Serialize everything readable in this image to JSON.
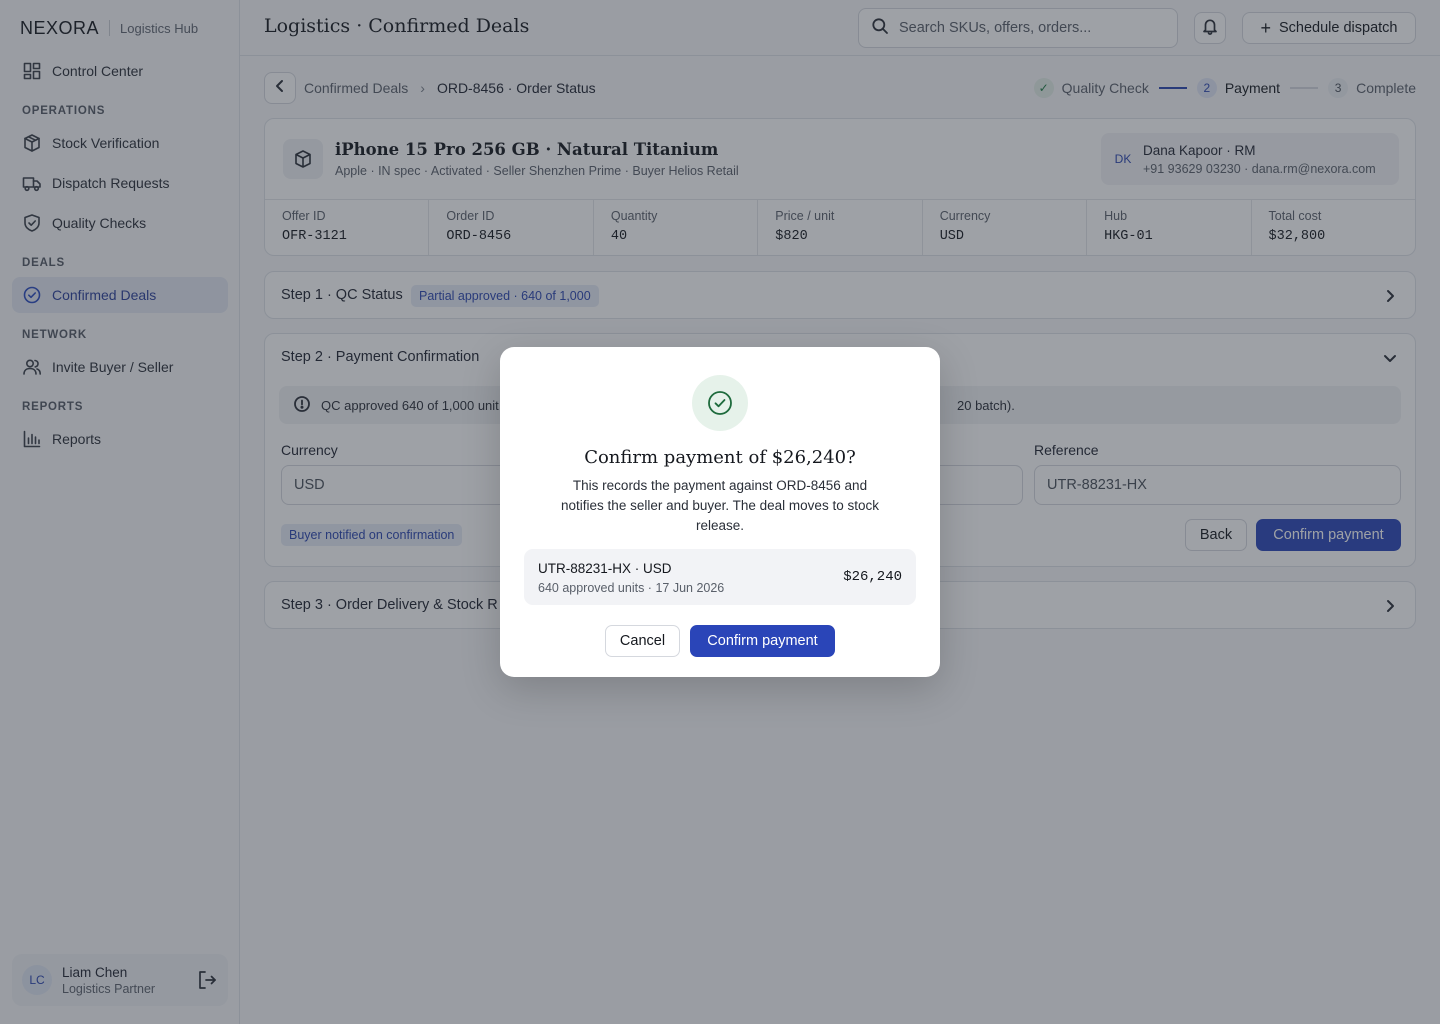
{
  "brand": {
    "logo": "NEXORA",
    "subtitle": "Logistics Hub"
  },
  "sidebar": {
    "items": [
      {
        "label": "Control Center",
        "icon": "dashboard-icon"
      },
      {
        "label": "Stock Verification",
        "icon": "box-icon"
      },
      {
        "label": "Dispatch Requests",
        "icon": "truck-icon"
      },
      {
        "label": "Quality Checks",
        "icon": "shield-check-icon"
      },
      {
        "label": "Confirmed Deals",
        "icon": "check-circle-icon"
      },
      {
        "label": "Invite Buyer / Seller",
        "icon": "users-icon"
      },
      {
        "label": "Reports",
        "icon": "bar-chart-icon"
      }
    ],
    "sections": [
      "OPERATIONS",
      "DEALS",
      "NETWORK",
      "REPORTS"
    ],
    "active": "Confirmed Deals"
  },
  "user": {
    "initials": "LC",
    "name": "Liam Chen",
    "role": "Logistics Partner"
  },
  "header": {
    "title": "Logistics · Confirmed Deals",
    "search_placeholder": "Search SKUs, offers, orders...",
    "schedule_label": "Schedule dispatch"
  },
  "breadcrumb": {
    "parent": "Confirmed Deals",
    "current": "ORD-8456 · Order Status"
  },
  "stepper": [
    {
      "num": "✓",
      "label": "Quality Check",
      "state": "done"
    },
    {
      "num": "2",
      "label": "Payment",
      "state": "current"
    },
    {
      "num": "3",
      "label": "Complete",
      "state": "todo"
    }
  ],
  "product": {
    "title": "iPhone 15 Pro 256 GB · Natural Titanium",
    "subtitle": "Apple · IN spec · Activated · Seller Shenzhen Prime · Buyer Helios Retail",
    "rm_initials": "DK",
    "rm_name": "Dana Kapoor · RM",
    "rm_contact": "+91 93629 03230 · dana.rm@nexora.com",
    "meta": [
      {
        "key": "Offer ID",
        "value": "OFR-3121"
      },
      {
        "key": "Order ID",
        "value": "ORD-8456"
      },
      {
        "key": "Quantity",
        "value": "40"
      },
      {
        "key": "Price / unit",
        "value": "$820"
      },
      {
        "key": "Currency",
        "value": "USD"
      },
      {
        "key": "Hub",
        "value": "HKG-01"
      },
      {
        "key": "Total cost",
        "value": "$32,800"
      }
    ]
  },
  "step1": {
    "title": "Step 1 · QC Status",
    "badge": "Partial approved · 640 of 1,000"
  },
  "step2": {
    "title": "Step 2 · Payment Confirmation",
    "info_left": "QC approved 640 of 1,000 unit",
    "info_right": "20 batch).",
    "currency_label": "Currency",
    "currency_value": "USD",
    "reference_label": "Reference",
    "reference_value": "UTR-88231-HX",
    "notify_badge": "Buyer notified on confirmation",
    "back_label": "Back",
    "confirm_label": "Confirm payment"
  },
  "step3": {
    "title": "Step 3 · Order Delivery & Stock R"
  },
  "modal": {
    "title": "Confirm payment of $26,240?",
    "body": "This records the payment against ORD-8456 and notifies the seller and buyer. The deal moves to stock release.",
    "ref_line": "UTR-88231-HX · USD",
    "sub_line": "640 approved units · 17 Jun 2026",
    "amount": "$26,240",
    "cancel_label": "Cancel",
    "confirm_label": "Confirm payment"
  },
  "colors": {
    "accent": "#2a45b8",
    "success": "#1e6b3c",
    "badge_bg": "#e6ebf6"
  }
}
